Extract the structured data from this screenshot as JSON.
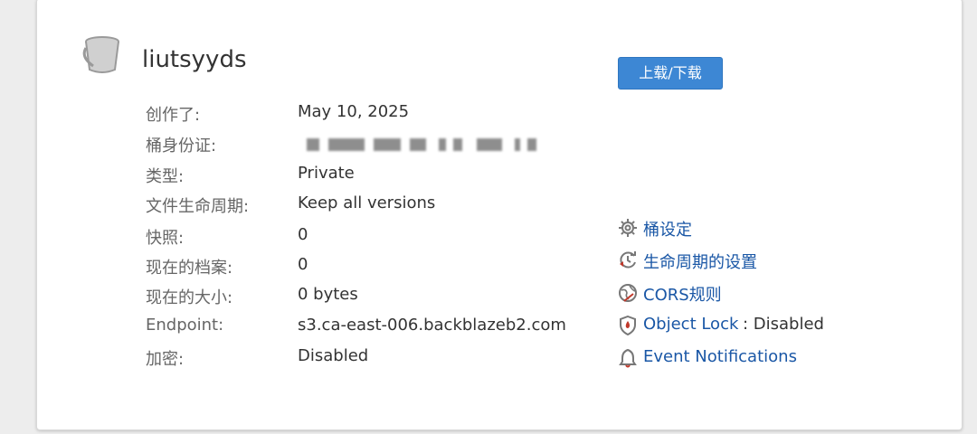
{
  "bucket": {
    "name": "liutsyyds",
    "upload_label": "上载/下载"
  },
  "info": [
    {
      "label": "创作了:",
      "value": "May 10, 2025"
    },
    {
      "label": "桶身份证:",
      "value": ""
    },
    {
      "label": "类型:",
      "value": "Private"
    },
    {
      "label": "文件生命周期:",
      "value": "Keep all versions"
    },
    {
      "label": "快照:",
      "value": "0"
    },
    {
      "label": "现在的档案:",
      "value": "0"
    },
    {
      "label": "现在的大小:",
      "value": "0 bytes"
    },
    {
      "label": "Endpoint:",
      "value": "s3.ca-east-006.backblazeb2.com"
    },
    {
      "label": "加密:",
      "value": "Disabled"
    }
  ],
  "links": [
    {
      "label": "桶设定",
      "icon": "gear-icon"
    },
    {
      "label": "生命周期的设置",
      "icon": "lifecycle-icon"
    },
    {
      "label": "CORS规则",
      "icon": "globe-icon"
    },
    {
      "label": "Object Lock",
      "suffix": ": Disabled",
      "icon": "shield-lock-icon"
    },
    {
      "label": "Event Notifications",
      "icon": "bell-icon"
    }
  ],
  "colors": {
    "primary_button": "#3d87d4",
    "link": "#1a57a6",
    "label": "#666666",
    "value": "#333333"
  }
}
